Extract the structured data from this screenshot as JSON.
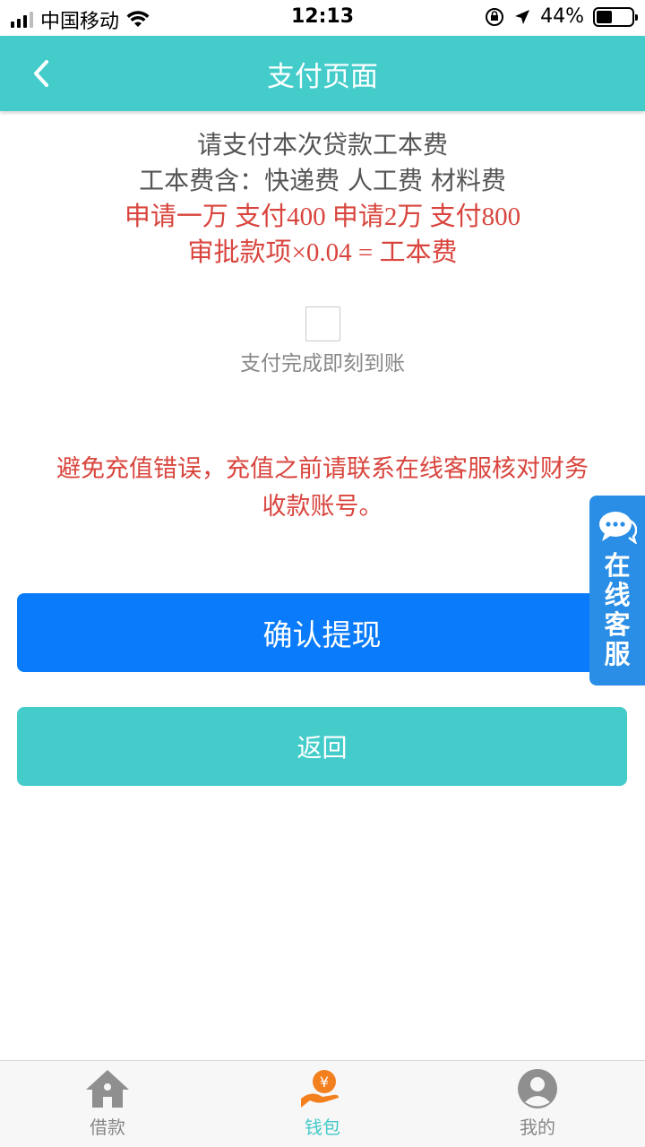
{
  "status_bar": {
    "carrier": "中国移动",
    "time": "12:13",
    "battery_percent": "44%",
    "battery_level": 0.44
  },
  "nav": {
    "title": "支付页面"
  },
  "info": {
    "line1": "请支付本次贷款工本费",
    "line2": "工本费含：快递费 人工费 材料费",
    "line3": "申请一万 支付400 申请2万 支付800",
    "line4": "审批款项×0.04 = 工本费"
  },
  "payment": {
    "checkbox_label": "支付完成即刻到账",
    "checked": false
  },
  "warning": {
    "line1": "避免充值错误，充值之前请联系在线客服核对财务",
    "line2": "收款账号。"
  },
  "buttons": {
    "confirm_label": "确认提现",
    "back_label": "返回"
  },
  "float_service": {
    "label": "在线客服"
  },
  "tabs": [
    {
      "label": "借款",
      "icon": "home-icon",
      "active": false
    },
    {
      "label": "钱包",
      "icon": "wallet-icon",
      "active": true
    },
    {
      "label": "我的",
      "icon": "user-icon",
      "active": false
    }
  ],
  "colors": {
    "nav": "#44cccb",
    "confirm_button": "#0a7bfa",
    "alert_text": "#d9453e",
    "float_service": "#2a8ee6",
    "active_tab": "#40c9c8"
  }
}
